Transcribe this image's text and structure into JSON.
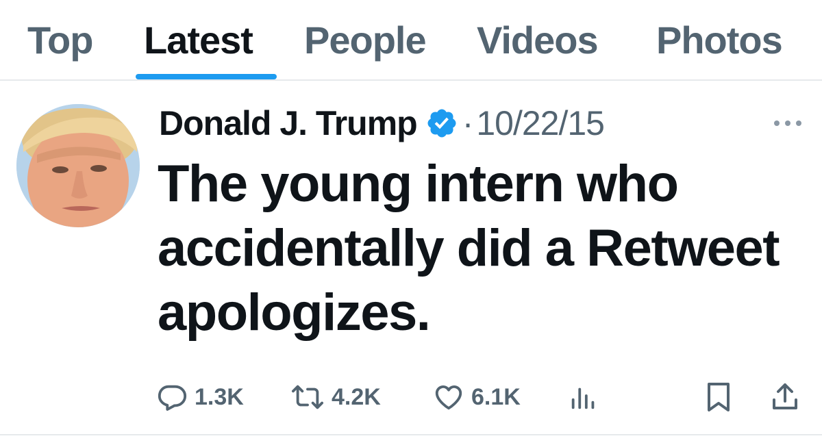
{
  "tabs": [
    {
      "label": "Top",
      "active": false
    },
    {
      "label": "Latest",
      "active": true
    },
    {
      "label": "People",
      "active": false
    },
    {
      "label": "Videos",
      "active": false
    },
    {
      "label": "Photos",
      "active": false
    }
  ],
  "tweet": {
    "author": "Donald J. Trump",
    "verified": true,
    "separator": "·",
    "date": "10/22/15",
    "text": "The young intern who accidentally did a Retweet apologizes.",
    "actions": {
      "replies": "1.3K",
      "retweets": "4.2K",
      "likes": "6.1K"
    },
    "icons": {
      "reply": "speech-bubble",
      "retweet": "retweet-arrows",
      "like": "heart",
      "views": "bar-chart",
      "bookmark": "bookmark",
      "share": "share-upload",
      "more": "ellipsis"
    }
  },
  "colors": {
    "accent": "#1d9bf0",
    "text_primary": "#0f1419",
    "text_secondary": "#536471",
    "divider": "#e6e9ec"
  }
}
